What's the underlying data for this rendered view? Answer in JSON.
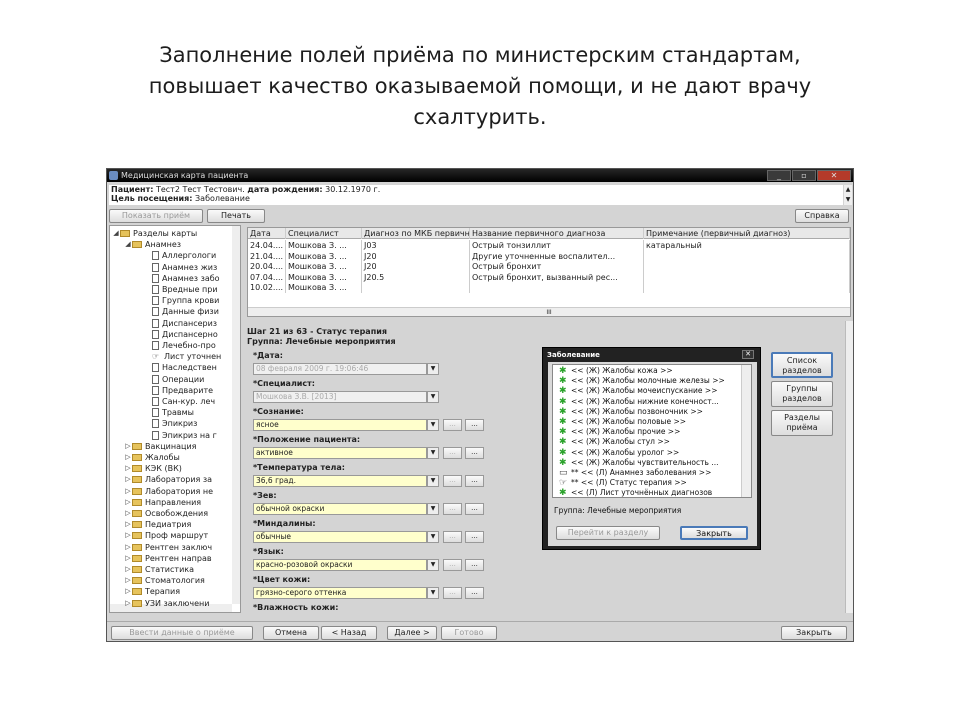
{
  "slide": {
    "title_lines": [
      "Заполнение полей приёма по министерским стандартам,",
      "повышает качество оказываемой помощи, и не дают врачу",
      "схалтурить."
    ]
  },
  "window": {
    "title": "Медицинская карта пациента",
    "buttons": [
      "_",
      "▫",
      "✕"
    ]
  },
  "patient": {
    "patient_label": "Пациент:",
    "patient_name": "Тест2 Тест Тестович.",
    "dob_label": "дата рождения:",
    "dob": "30.12.1970 г.",
    "visit_label": "Цель посещения:",
    "visit": "Заболевание"
  },
  "toolbar": {
    "show_label": "Показать приём",
    "print_label": "Печать",
    "help_label": "Справка"
  },
  "tree": {
    "items": [
      {
        "label": "Разделы карты",
        "kind": "root",
        "exp": "◢"
      },
      {
        "label": "Анамнез",
        "kind": "folder",
        "exp": "◢"
      },
      {
        "label": "Аллергологи",
        "kind": "doc"
      },
      {
        "label": "Анамнез жиз",
        "kind": "doc"
      },
      {
        "label": "Анамнез забо",
        "kind": "doc"
      },
      {
        "label": "Вредные при",
        "kind": "doc"
      },
      {
        "label": "Группа крови",
        "kind": "doc"
      },
      {
        "label": "Данные физи",
        "kind": "doc"
      },
      {
        "label": "Диспансериз",
        "kind": "doc"
      },
      {
        "label": "Диспансерно",
        "kind": "doc"
      },
      {
        "label": "Лечебно-про",
        "kind": "doc"
      },
      {
        "label": "Лист уточнен",
        "kind": "hand"
      },
      {
        "label": "Наследствен",
        "kind": "doc"
      },
      {
        "label": "Операции",
        "kind": "doc"
      },
      {
        "label": "Предварите",
        "kind": "doc"
      },
      {
        "label": "Сан-кур. леч",
        "kind": "doc"
      },
      {
        "label": "Травмы",
        "kind": "doc"
      },
      {
        "label": "Эпикриз",
        "kind": "doc"
      },
      {
        "label": "Эпикриз на г",
        "kind": "doc"
      },
      {
        "label": "Вакцинация",
        "kind": "folder",
        "exp": "▷"
      },
      {
        "label": "Жалобы",
        "kind": "folder",
        "exp": "▷"
      },
      {
        "label": "КЭК (ВК)",
        "kind": "folder",
        "exp": "▷"
      },
      {
        "label": "Лаборатория за",
        "kind": "folder",
        "exp": "▷"
      },
      {
        "label": "Лаборатория не",
        "kind": "folder",
        "exp": "▷"
      },
      {
        "label": "Направления",
        "kind": "folder",
        "exp": "▷"
      },
      {
        "label": "Освобождения",
        "kind": "folder",
        "exp": "▷"
      },
      {
        "label": "Педиатрия",
        "kind": "folder",
        "exp": "▷"
      },
      {
        "label": "Проф маршрут",
        "kind": "folder",
        "exp": "▷"
      },
      {
        "label": "Рентген заключ",
        "kind": "folder",
        "exp": "▷"
      },
      {
        "label": "Рентген направ",
        "kind": "folder",
        "exp": "▷"
      },
      {
        "label": "Статистика",
        "kind": "folder",
        "exp": "▷"
      },
      {
        "label": "Стоматология",
        "kind": "folder",
        "exp": "▷"
      },
      {
        "label": "Терапия",
        "kind": "folder",
        "exp": "▷"
      },
      {
        "label": "УЗИ заключени",
        "kind": "folder",
        "exp": "▷"
      }
    ]
  },
  "grid": {
    "headers": [
      "Дата",
      "Специалист",
      "Диагноз по МКБ первичный",
      "Название первичного диагноза",
      "Примечание (первичный диагноз)"
    ],
    "rows": [
      [
        "24.04....",
        "Мошкова З. ...",
        "J03",
        "Острый тонзиллит",
        "катаральный"
      ],
      [
        "21.04....",
        "Мошкова З. ...",
        "J20",
        "Другие уточненные воспалител...",
        ""
      ],
      [
        "20.04....",
        "Мошкова З. ...",
        "J20",
        "Острый бронхит",
        ""
      ],
      [
        "07.04....",
        "Мошкова З. ...",
        "J20.5",
        "Острый бронхит, вызванный рес...",
        ""
      ],
      [
        "10.02....",
        "Мошкова З. ...",
        "",
        "",
        ""
      ]
    ],
    "scroll_mark": "III"
  },
  "form": {
    "step": "Шаг 21 из 63 - Статус терапия",
    "group": "Группа: Лечебные мероприятия",
    "fields": [
      {
        "label": "*Дата:",
        "value": "08 февраля 2009 г.   19:06:46",
        "disabled": true,
        "buttons": false
      },
      {
        "label": "*Специалист:",
        "value": "Мошкова З.В. [2013]",
        "disabled": true,
        "buttons": false
      },
      {
        "label": "*Сознание:",
        "value": "ясное",
        "disabled": false,
        "buttons": true
      },
      {
        "label": "*Положение пациента:",
        "value": "активное",
        "disabled": false,
        "buttons": true
      },
      {
        "label": "*Температура тела:",
        "value": "36,6 град.",
        "disabled": false,
        "buttons": true
      },
      {
        "label": "*Зев:",
        "value": "обычной окраски",
        "disabled": false,
        "buttons": true
      },
      {
        "label": "*Миндалины:",
        "value": "обычные",
        "disabled": false,
        "buttons": true
      },
      {
        "label": "*Язык:",
        "value": "красно-розовой окраски",
        "disabled": false,
        "buttons": true
      },
      {
        "label": "*Цвет кожи:",
        "value": "грязно-серого оттенка",
        "disabled": false,
        "buttons": true
      },
      {
        "label": "*Влажность кожи:",
        "value": "",
        "disabled": false,
        "buttons": false
      }
    ],
    "dots": "...",
    "dropdown_glyph": "▼"
  },
  "dialog": {
    "title": "Заболевание",
    "close": "✕",
    "items": [
      {
        "text": "<< (Ж) Жалобы кожа >>",
        "icon": "star"
      },
      {
        "text": "<< (Ж) Жалобы молочные железы >>",
        "icon": "star"
      },
      {
        "text": "<< (Ж) Жалобы мочеиспускание >>",
        "icon": "star"
      },
      {
        "text": "<< (Ж) Жалобы нижние конечност...",
        "icon": "star"
      },
      {
        "text": "<< (Ж) Жалобы позвоночник >>",
        "icon": "star"
      },
      {
        "text": "<< (Ж) Жалобы половые >>",
        "icon": "star"
      },
      {
        "text": "<< (Ж) Жалобы прочие >>",
        "icon": "star"
      },
      {
        "text": "<< (Ж) Жалобы стул >>",
        "icon": "star"
      },
      {
        "text": "<< (Ж) Жалобы уролог >>",
        "icon": "star"
      },
      {
        "text": "<< (Ж) Жалобы чувствительность ...",
        "icon": "star"
      },
      {
        "text": "** << (Л) Анамнез заболевания >>",
        "icon": "doc"
      },
      {
        "text": "** << (Л) Статус терапия >>",
        "icon": "hand"
      },
      {
        "text": "<< (Л) Лист уточнённых диагнозов",
        "icon": "star"
      }
    ],
    "group": "Группа: Лечебные мероприятия",
    "goto_label": "Перейти к разделу",
    "close_label": "Закрыть"
  },
  "right_buttons": {
    "list_label": "Список разделов",
    "groups_label": "Группы разделов",
    "sections_label": "Разделы приёма"
  },
  "bottom": {
    "enter_label": "Ввести данные о приёме",
    "cancel_label": "Отмена",
    "back_label": "< Назад",
    "next_label": "Далее >",
    "done_label": "Готово",
    "close_label": "Закрыть"
  }
}
